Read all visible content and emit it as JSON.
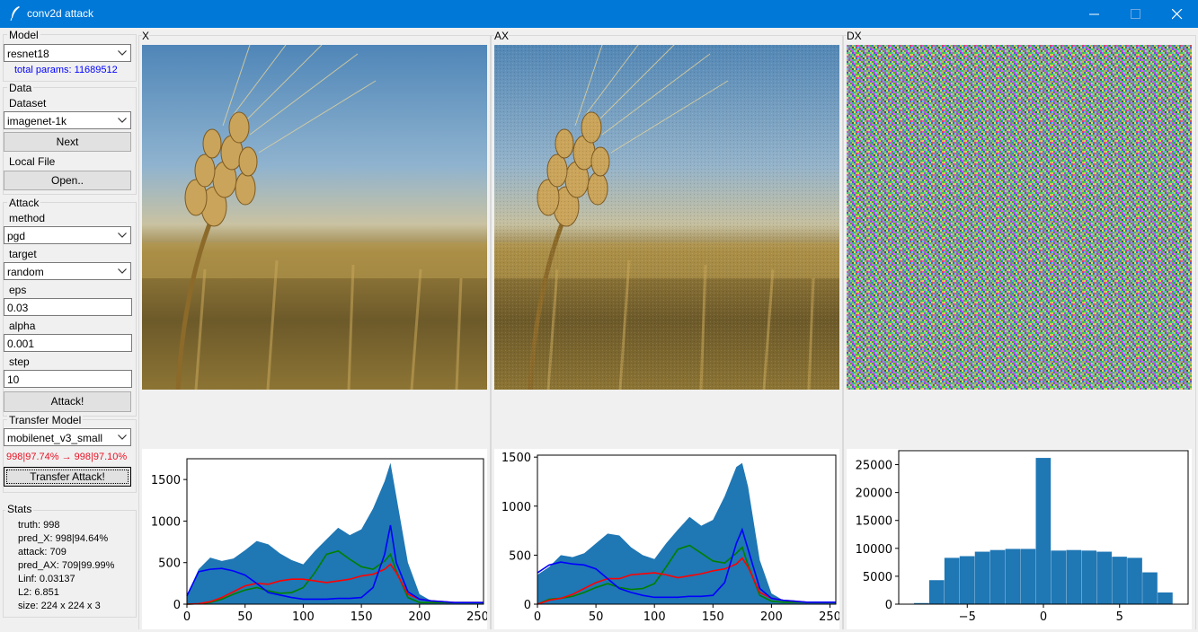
{
  "window": {
    "title": "conv2d attack"
  },
  "model": {
    "group_label": "Model",
    "selected": "resnet18",
    "params_text": "total params: 11689512"
  },
  "data": {
    "group_label": "Data",
    "dataset_label": "Dataset",
    "dataset_selected": "imagenet-1k",
    "next_label": "Next",
    "local_file_label": "Local File",
    "open_label": "Open.."
  },
  "attack": {
    "group_label": "Attack",
    "method_label": "method",
    "method_selected": "pgd",
    "target_label": "target",
    "target_selected": "random",
    "eps_label": "eps",
    "eps_value": "0.03",
    "alpha_label": "alpha",
    "alpha_value": "0.001",
    "step_label": "step",
    "step_value": "10",
    "attack_button": "Attack!"
  },
  "transfer": {
    "group_label": "Transfer Model",
    "selected": "mobilenet_v3_small",
    "result_text": "998|97.74% → 998|97.10%",
    "button": "Transfer Attack!"
  },
  "stats": {
    "group_label": "Stats",
    "lines": [
      "truth: 998",
      "pred_X: 998|94.64%",
      "attack: 709",
      "pred_AX: 709|99.99%",
      "Linf: 0.03137",
      "L2: 6.851",
      "size: 224 x 224 x 3"
    ]
  },
  "columns": [
    {
      "label": "X",
      "image_icon": "wheat-image"
    },
    {
      "label": "AX",
      "image_icon": "wheat-image-perturbed"
    },
    {
      "label": "DX",
      "image_icon": "noise-image"
    }
  ],
  "colors": {
    "titlebar": "#0078d7",
    "params_text": "#0000ff",
    "transfer_text": "#e81123",
    "hist_fill": "#1f77b4",
    "red_channel": "#ff0000",
    "green_channel": "#008000",
    "blue_channel": "#0000ff"
  },
  "chart_data": [
    {
      "type": "area",
      "panel": "X",
      "xlim": [
        0,
        255
      ],
      "ylim": [
        0,
        1750
      ],
      "xticks": [
        "0",
        "50",
        "100",
        "150",
        "200",
        "250"
      ],
      "yticks": [
        "0",
        "500",
        "1000",
        "1500"
      ],
      "x": [
        0,
        10,
        20,
        30,
        40,
        50,
        60,
        70,
        80,
        90,
        100,
        110,
        120,
        130,
        140,
        150,
        160,
        170,
        175,
        180,
        190,
        200,
        210,
        220,
        230,
        240,
        255
      ],
      "series": [
        {
          "values": [
            100,
            420,
            560,
            520,
            550,
            650,
            760,
            720,
            610,
            530,
            480,
            640,
            780,
            920,
            830,
            900,
            1150,
            1480,
            1700,
            1300,
            500,
            120,
            40,
            30,
            20,
            20,
            20
          ]
        },
        {
          "values": [
            0,
            5,
            20,
            60,
            120,
            170,
            200,
            160,
            130,
            140,
            200,
            380,
            600,
            640,
            540,
            450,
            420,
            520,
            600,
            400,
            80,
            20,
            20,
            20,
            20,
            20,
            20
          ]
        },
        {
          "values": [
            0,
            5,
            30,
            80,
            150,
            220,
            250,
            240,
            280,
            300,
            300,
            280,
            260,
            280,
            300,
            340,
            360,
            420,
            480,
            380,
            120,
            60,
            40,
            30,
            20,
            20,
            20
          ]
        },
        {
          "values": [
            100,
            390,
            420,
            430,
            400,
            350,
            250,
            140,
            110,
            80,
            60,
            60,
            60,
            70,
            70,
            80,
            200,
            600,
            950,
            500,
            150,
            60,
            40,
            30,
            20,
            20,
            20
          ]
        }
      ]
    },
    {
      "type": "area",
      "panel": "AX",
      "xlim": [
        0,
        255
      ],
      "ylim": [
        0,
        1520
      ],
      "xticks": [
        "0",
        "50",
        "100",
        "150",
        "200",
        "250"
      ],
      "yticks": [
        "0",
        "500",
        "1000",
        "1500"
      ],
      "x": [
        0,
        10,
        20,
        30,
        40,
        50,
        60,
        70,
        80,
        90,
        100,
        110,
        120,
        130,
        140,
        150,
        160,
        170,
        175,
        180,
        190,
        200,
        210,
        220,
        230,
        240,
        255
      ],
      "series": [
        {
          "values": [
            300,
            380,
            500,
            480,
            520,
            620,
            720,
            700,
            580,
            500,
            460,
            620,
            760,
            890,
            800,
            860,
            1100,
            1400,
            1440,
            1200,
            450,
            110,
            40,
            30,
            20,
            20,
            20
          ]
        },
        {
          "values": [
            0,
            50,
            60,
            80,
            120,
            170,
            210,
            170,
            150,
            160,
            210,
            380,
            560,
            600,
            520,
            440,
            420,
            520,
            580,
            400,
            90,
            30,
            20,
            20,
            20,
            20,
            20
          ]
        },
        {
          "values": [
            0,
            40,
            60,
            100,
            160,
            220,
            260,
            260,
            300,
            310,
            320,
            300,
            270,
            290,
            310,
            340,
            360,
            410,
            470,
            380,
            120,
            60,
            40,
            30,
            20,
            20,
            20
          ]
        },
        {
          "values": [
            320,
            400,
            430,
            410,
            400,
            360,
            260,
            160,
            120,
            90,
            70,
            70,
            70,
            80,
            80,
            90,
            220,
            620,
            760,
            560,
            160,
            60,
            40,
            30,
            20,
            20,
            20
          ]
        }
      ]
    },
    {
      "type": "bar",
      "panel": "DX",
      "xlim": [
        -9.5,
        9.5
      ],
      "ylim": [
        0,
        27500
      ],
      "xticks": [
        "−5",
        "0",
        "5"
      ],
      "yticks": [
        "0",
        "5000",
        "10000",
        "15000",
        "20000",
        "25000"
      ],
      "categories": [
        "-8",
        "-7",
        "-6",
        "-5",
        "-4",
        "-3",
        "-2",
        "-1",
        "0",
        "1",
        "2",
        "3",
        "4",
        "5",
        "6",
        "7",
        "8"
      ],
      "values": [
        200,
        4300,
        8300,
        8600,
        9400,
        9700,
        9900,
        9900,
        26200,
        9600,
        9700,
        9600,
        9400,
        8500,
        8300,
        5700,
        2100
      ]
    }
  ]
}
